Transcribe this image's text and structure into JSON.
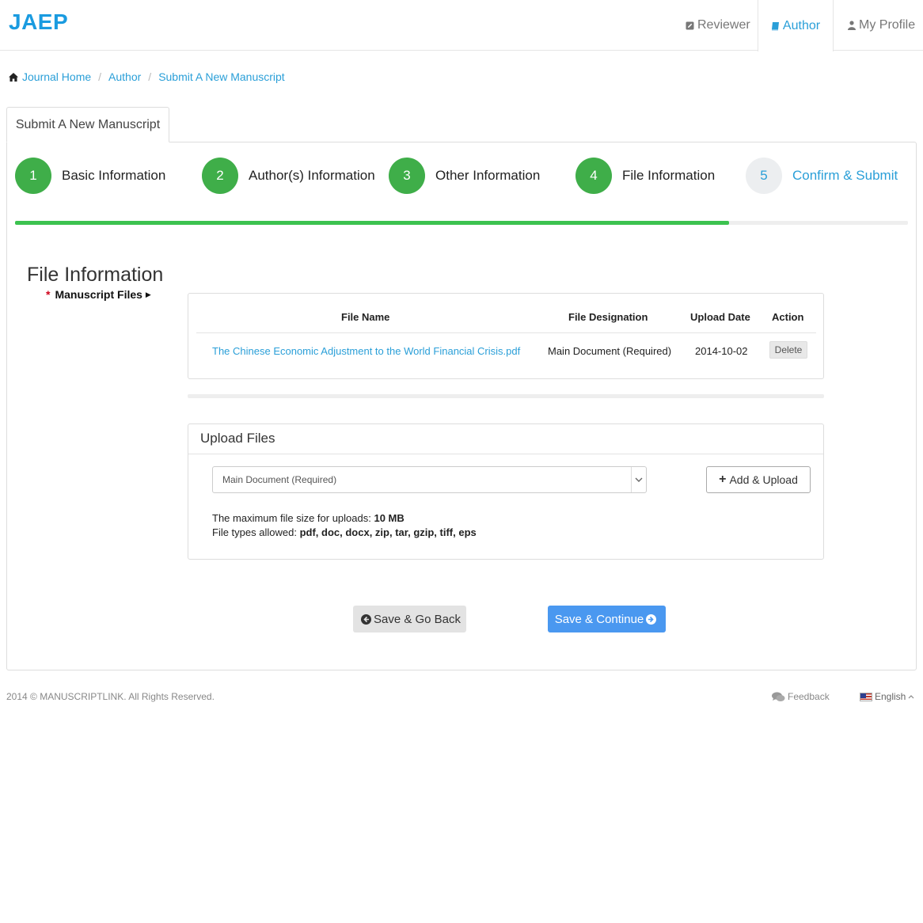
{
  "brand": "JAEP",
  "nav": {
    "reviewer": "Reviewer",
    "author": "Author",
    "profile": "My Profile"
  },
  "breadcrumb": [
    "Journal Home",
    "Author",
    "Submit A New Manuscript"
  ],
  "tab_label": "Submit A New Manuscript",
  "steps": [
    {
      "number": "1",
      "label": "Basic Information"
    },
    {
      "number": "2",
      "label": "Author(s) Information"
    },
    {
      "number": "3",
      "label": "Other Information"
    },
    {
      "number": "4",
      "label": "File Information"
    },
    {
      "number": "5",
      "label": "Confirm & Submit"
    }
  ],
  "progress_fraction": 0.8,
  "section_title": "File Information",
  "field_label": {
    "required_mark": "*",
    "text": "Manuscript Files"
  },
  "files_table": {
    "headers": [
      "File Name",
      "File Designation",
      "Upload Date",
      "Action"
    ],
    "rows": [
      {
        "file_name": "The Chinese Economic Adjustment to the World Financial Crisis.pdf",
        "designation": "Main Document (Required)",
        "date": "2014-10-02",
        "action": "Delete"
      }
    ]
  },
  "upload": {
    "heading": "Upload Files",
    "selected_designation": "Main Document (Required)",
    "add_button": "Add & Upload",
    "max_size_label": "The maximum file size for uploads:",
    "max_size_value": "10 MB",
    "types_label": "File types allowed:",
    "types_value": "pdf, doc, docx, zip, tar, gzip, tiff, eps"
  },
  "buttons": {
    "back": "Save & Go Back",
    "continue": "Save & Continue"
  },
  "footer": {
    "copyright": "2014 © MANUSCRIPTLINK. All Rights Reserved.",
    "feedback": "Feedback",
    "language": "English"
  },
  "colors": {
    "brand": "#1a9be0",
    "link": "#2a9fd8",
    "step_done": "#3fae49",
    "progress": "#3cc24f",
    "primary_button": "#4a98f0",
    "required": "#d0021b"
  }
}
